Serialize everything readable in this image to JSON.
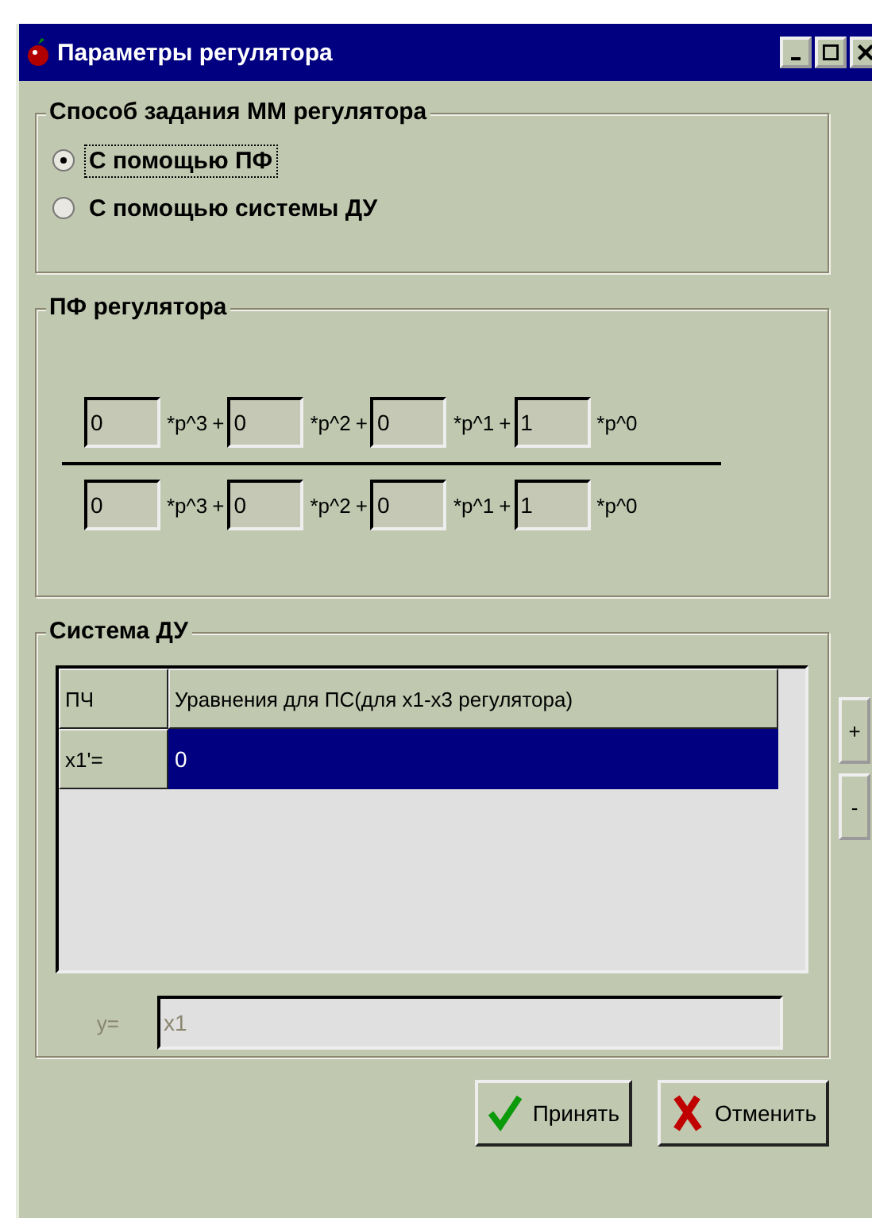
{
  "window": {
    "title": "Параметры регулятора"
  },
  "mode_group": {
    "title": "Способ задания ММ регулятора",
    "options": [
      {
        "label": "С помощью ПФ",
        "selected": true,
        "focused": true
      },
      {
        "label": "С помощью системы ДУ",
        "selected": false,
        "focused": false
      }
    ]
  },
  "tf_group": {
    "title": "ПФ регулятора",
    "rows": [
      [
        {
          "kind": "field",
          "value": "0"
        },
        {
          "kind": "text",
          "text": "*p^3"
        },
        {
          "kind": "op",
          "text": "+"
        },
        {
          "kind": "field",
          "value": "0"
        },
        {
          "kind": "text",
          "text": "*p^2"
        },
        {
          "kind": "op",
          "text": "+"
        },
        {
          "kind": "field",
          "value": "0"
        },
        {
          "kind": "text",
          "text": "*p^1"
        },
        {
          "kind": "op",
          "text": "+"
        },
        {
          "kind": "field",
          "value": "1"
        },
        {
          "kind": "text",
          "text": "*p^0"
        }
      ],
      [
        {
          "kind": "field",
          "value": "0"
        },
        {
          "kind": "text",
          "text": "*p^3"
        },
        {
          "kind": "op",
          "text": "+"
        },
        {
          "kind": "field",
          "value": "0"
        },
        {
          "kind": "text",
          "text": "*p^2"
        },
        {
          "kind": "op",
          "text": "+"
        },
        {
          "kind": "field",
          "value": "0"
        },
        {
          "kind": "text",
          "text": "*p^1"
        },
        {
          "kind": "op",
          "text": "+"
        },
        {
          "kind": "field",
          "value": "1"
        },
        {
          "kind": "text",
          "text": "*p^0"
        }
      ]
    ]
  },
  "system_group": {
    "title": "Система ДУ",
    "table": {
      "columns": [
        "ПЧ",
        "Уравнения для ПС(для x1-x3 регулятора)"
      ],
      "rows": [
        {
          "cells": [
            "x1'=",
            "0"
          ],
          "selected": true
        }
      ]
    },
    "output": {
      "label": "y=",
      "value": "x1",
      "disabled": true
    }
  },
  "side_buttons": [
    "+",
    "-"
  ],
  "buttons": [
    {
      "kind": "accept",
      "label": "Принять"
    },
    {
      "kind": "cancel",
      "label": "Отменить"
    }
  ]
}
